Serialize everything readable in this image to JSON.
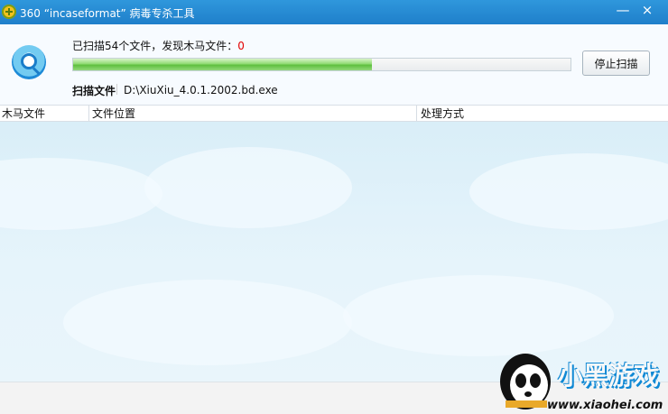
{
  "window": {
    "title": "360 “incaseformat” 病毒专杀工具",
    "minimize": "—",
    "close": "×"
  },
  "scan": {
    "status_prefix": "已扫描54个文件，发现木马文件：",
    "found_count": "0",
    "progress_percent": 60,
    "stop_button": "停止扫描",
    "file_label": "扫描文件",
    "current_file": "D:\\XiuXiu_4.0.1.2002.bd.exe"
  },
  "table": {
    "columns": [
      "木马文件",
      "文件位置",
      "处理方式"
    ],
    "rows": []
  },
  "branding": {
    "watermark_logo": "小黑游戏",
    "site": "www.xiaohei.com"
  },
  "colors": {
    "titlebar": "#2b90d8",
    "accent": "#5ebf3e",
    "count": "#e20000"
  }
}
